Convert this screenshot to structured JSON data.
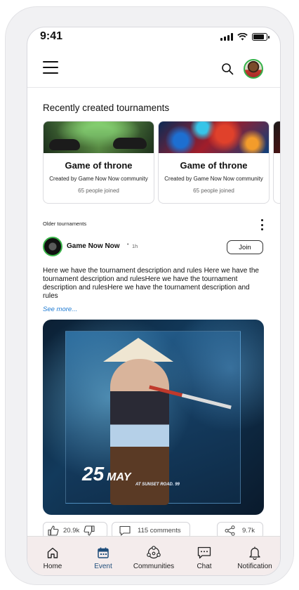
{
  "status": {
    "time": "9:41"
  },
  "header": {
    "menu_icon": "hamburger-icon",
    "search_icon": "search-icon",
    "avatar": "user-avatar"
  },
  "recent": {
    "title": "Recently created tournaments",
    "cards": [
      {
        "title": "Game of throne",
        "creator": "Created by Game Now Now community",
        "joined": "65 people joined",
        "image": "gaming-controllers"
      },
      {
        "title": "Game of throne",
        "creator": "Created by Game Now Now community",
        "joined": "65 people joined",
        "image": "colorful-paint"
      }
    ]
  },
  "older": {
    "title": "Older tournaments",
    "post": {
      "author": "Game Now Now",
      "dot": "•",
      "time": "1h",
      "join_label": "Join",
      "text": "Here we have the tournament description and rules Here we have the tournament description and rulesHere we have the tournament description and rulesHere we have the tournament description and rules",
      "see_more": "See more...",
      "poster": {
        "date_day": "25",
        "date_month": "MAY",
        "place": "AT SUNSET ROAD. 99"
      },
      "likes": "20.9k",
      "comments": "115 comments",
      "shares": "9.7k"
    }
  },
  "nav": [
    {
      "label": "Home",
      "icon": "home-icon",
      "active": false
    },
    {
      "label": "Event",
      "icon": "calendar-icon",
      "active": true
    },
    {
      "label": "Communities",
      "icon": "communities-icon",
      "active": false
    },
    {
      "label": "Chat",
      "icon": "chat-icon",
      "active": false
    },
    {
      "label": "Notification",
      "icon": "bell-icon",
      "active": false
    }
  ],
  "colors": {
    "accent": "#1f4d7a",
    "link": "#1e7ad2",
    "avatar_ring": "#34b24a",
    "nav_bg": "#f4ecec"
  }
}
